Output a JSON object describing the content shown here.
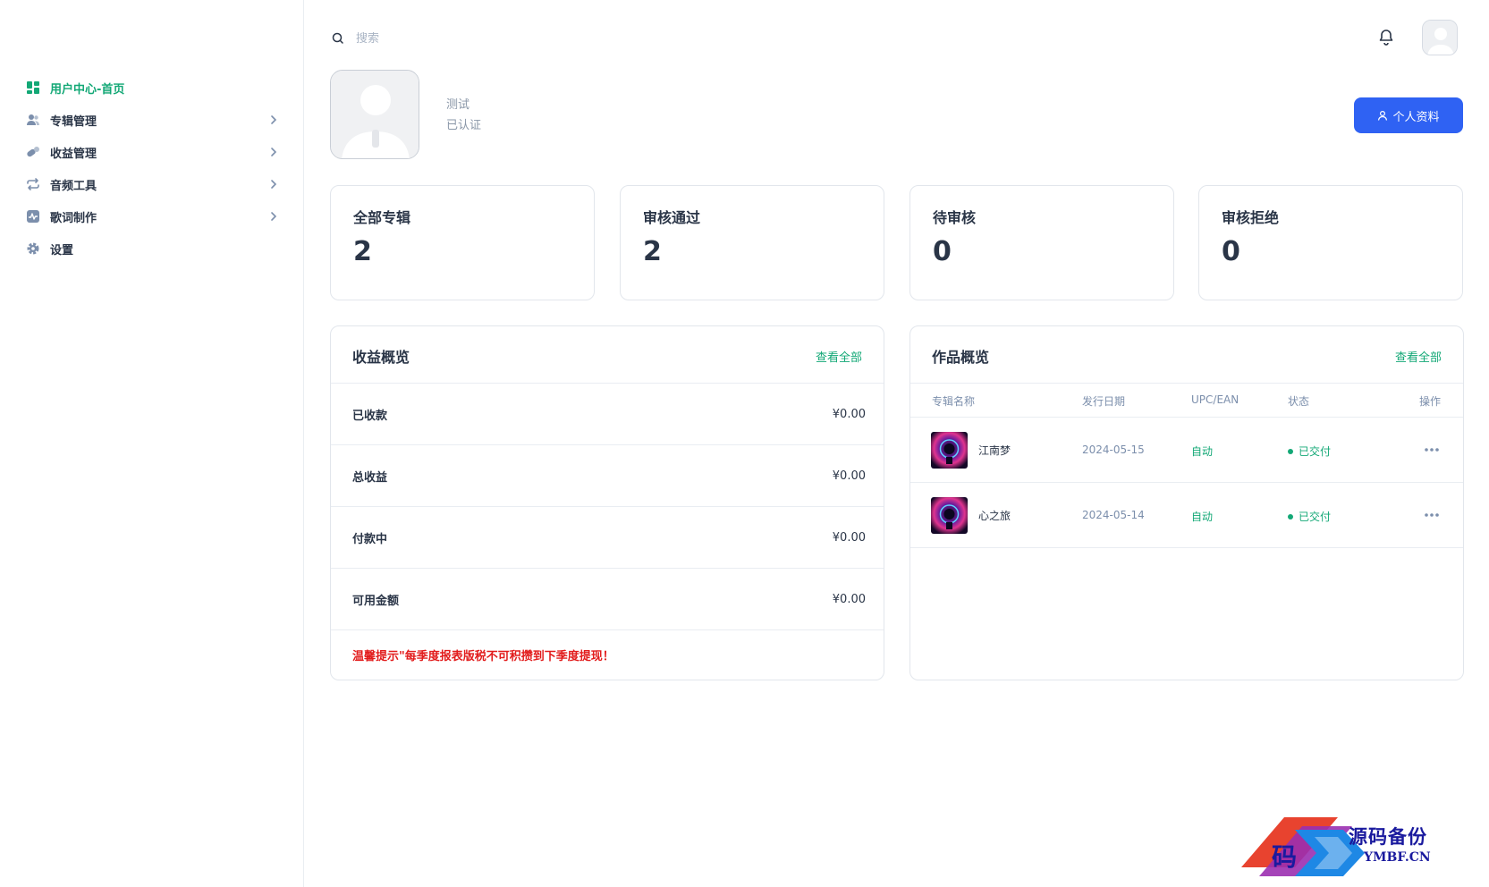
{
  "sidebar": {
    "items": [
      {
        "label": "用户中心-首页",
        "icon": "dashboard-icon",
        "active": true
      },
      {
        "label": "专辑管理",
        "icon": "users-icon"
      },
      {
        "label": "收益管理",
        "icon": "pills-icon"
      },
      {
        "label": "音频工具",
        "icon": "repeat-icon"
      },
      {
        "label": "歌词制作",
        "icon": "activity-icon"
      },
      {
        "label": "设置",
        "icon": "gear-icon"
      }
    ]
  },
  "header": {
    "search_placeholder": "搜索"
  },
  "profile": {
    "name": "测试",
    "status": "已认证",
    "button_label": "个人资料"
  },
  "stats": [
    {
      "label": "全部专辑",
      "value": "2"
    },
    {
      "label": "审核通过",
      "value": "2"
    },
    {
      "label": "待审核",
      "value": "0"
    },
    {
      "label": "审核拒绝",
      "value": "0"
    }
  ],
  "income": {
    "title": "收益概览",
    "view_all": "查看全部",
    "rows": [
      {
        "label": "已收款",
        "value": "¥0.00"
      },
      {
        "label": "总收益",
        "value": "¥0.00"
      },
      {
        "label": "付款中",
        "value": "¥0.00"
      },
      {
        "label": "可用金额",
        "value": "¥0.00"
      }
    ],
    "tip": "温馨提示\"每季度报表版税不可积攒到下季度提现！"
  },
  "works": {
    "title": "作品概览",
    "view_all": "查看全部",
    "columns": [
      "专辑名称",
      "发行日期",
      "UPC/EAN",
      "状态",
      "操作"
    ],
    "rows": [
      {
        "name": "江南梦",
        "date": "2024-05-15",
        "upc": "自动",
        "status": "已交付"
      },
      {
        "name": "心之旅",
        "date": "2024-05-14",
        "upc": "自动",
        "status": "已交付"
      }
    ]
  },
  "watermark": {
    "title": "源码备份",
    "domain": "YMBF.CN",
    "logo_char": "码"
  },
  "colors": {
    "accent_green": "#13a876",
    "primary_blue": "#2f62f3",
    "warning_red": "#e21c1c"
  }
}
